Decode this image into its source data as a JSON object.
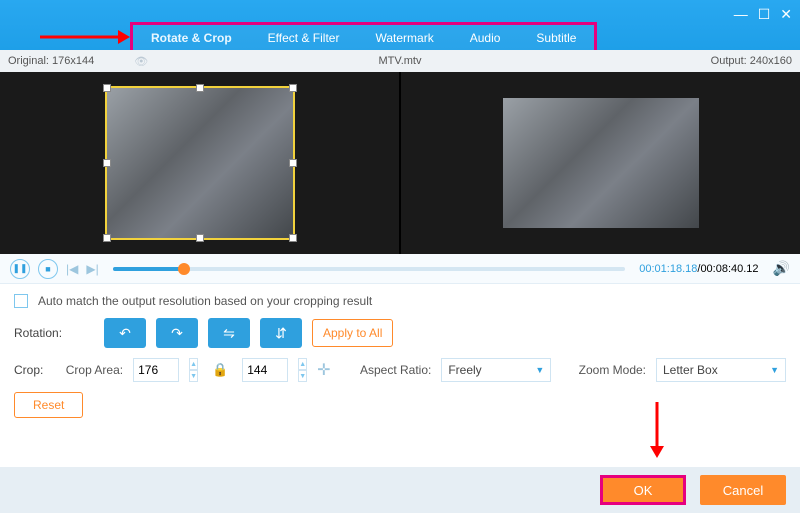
{
  "tabs": {
    "rotate_crop": "Rotate & Crop",
    "effect_filter": "Effect & Filter",
    "watermark": "Watermark",
    "audio": "Audio",
    "subtitle": "Subtitle"
  },
  "info": {
    "original": "Original: 176x144",
    "filename": "MTV.mtv",
    "output": "Output: 240x160"
  },
  "playback": {
    "current": "00:01:18.18",
    "total": "00:08:40.12"
  },
  "editor": {
    "checkbox_label": "Auto match the output resolution based on your cropping result",
    "rotation_label": "Rotation:",
    "apply_all": "Apply to All",
    "crop_label": "Crop:",
    "crop_area_label": "Crop Area:",
    "crop_w": "176",
    "crop_h": "144",
    "aspect_label": "Aspect Ratio:",
    "aspect_value": "Freely",
    "zoom_label": "Zoom Mode:",
    "zoom_value": "Letter Box",
    "reset": "Reset"
  },
  "footer": {
    "ok": "OK",
    "cancel": "Cancel"
  }
}
